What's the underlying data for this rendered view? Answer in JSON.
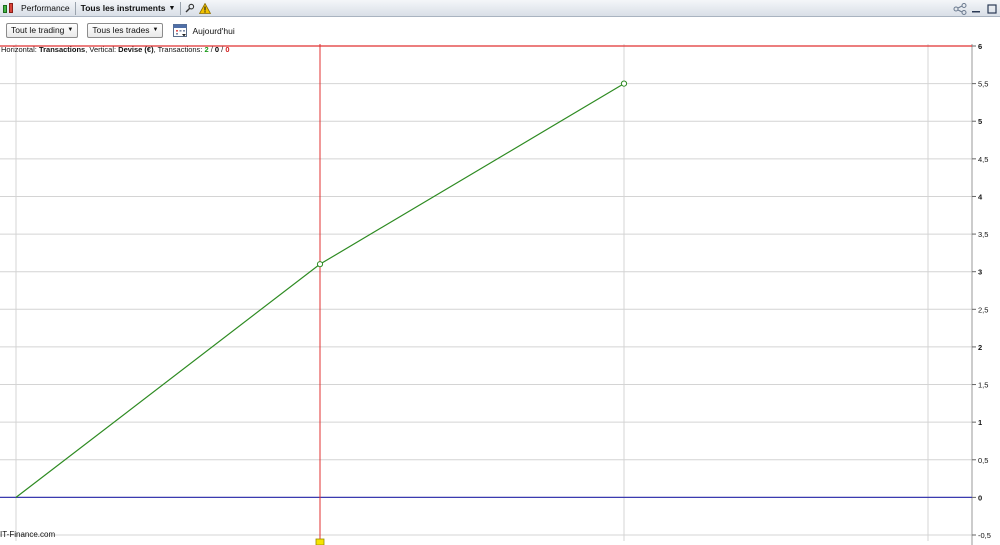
{
  "titlebar": {
    "tab_performance": "Performance",
    "tab_instruments": "Tous les instruments"
  },
  "toolbar": {
    "dropdown_trading": "Tout le trading",
    "dropdown_trades": "Tous les trades",
    "date_label": "Aujourd'hui"
  },
  "chart_info": {
    "horizontal_prefix": "Horizontal: ",
    "horizontal_value": "Transactions",
    "vertical_prefix": ", Vertical: ",
    "vertical_value": "Devise (€)",
    "transactions_prefix": ", Transactions: ",
    "count_total": "2",
    "count_zero": "0",
    "count_loss": "0",
    "sep": " / "
  },
  "watermark": "IT-Finance.com",
  "colors": {
    "line": "#2e8b22",
    "zero_line": "#3b3bb0",
    "red_line": "#e03030",
    "grid": "#d4d4d4"
  },
  "chart_data": {
    "type": "line",
    "x": [
      0,
      1,
      2
    ],
    "y": [
      0,
      3.1,
      5.5
    ],
    "ylim": [
      -0.5,
      6
    ],
    "y_ticks": [
      {
        "v": 6,
        "label": "6",
        "major": true
      },
      {
        "v": 5.5,
        "label": "5,5",
        "major": false
      },
      {
        "v": 5,
        "label": "5",
        "major": true
      },
      {
        "v": 4.5,
        "label": "4,5",
        "major": false
      },
      {
        "v": 4,
        "label": "4",
        "major": true
      },
      {
        "v": 3.5,
        "label": "3,5",
        "major": false
      },
      {
        "v": 3,
        "label": "3",
        "major": true
      },
      {
        "v": 2.5,
        "label": "2,5",
        "major": false
      },
      {
        "v": 2,
        "label": "2",
        "major": true
      },
      {
        "v": 1.5,
        "label": "1,5",
        "major": false
      },
      {
        "v": 1,
        "label": "1",
        "major": true
      },
      {
        "v": 0.5,
        "label": "0,5",
        "major": false
      },
      {
        "v": 0,
        "label": "0",
        "major": true
      },
      {
        "v": -0.5,
        "label": "-0,5",
        "major": false
      }
    ],
    "reference_lines": {
      "zero": 0,
      "top": 6
    },
    "cursor_x": 1,
    "grid": true
  }
}
